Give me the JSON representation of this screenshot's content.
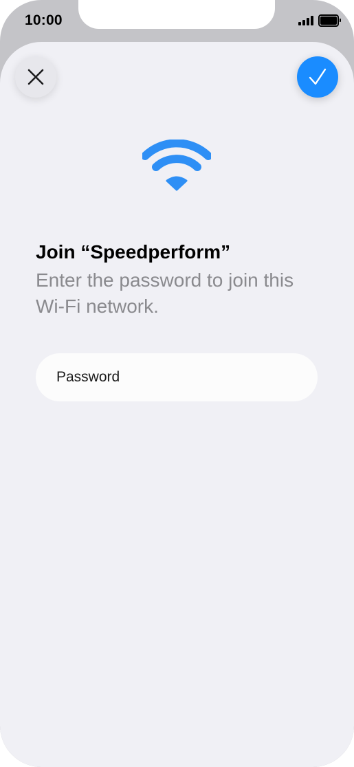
{
  "status_bar": {
    "time": "10:00",
    "signal_icon": "cellular-signal-icon",
    "battery_icon": "battery-full-icon"
  },
  "toolbar": {
    "close_icon": "close-icon",
    "confirm_icon": "checkmark-icon"
  },
  "content": {
    "wifi_icon": "wifi-icon",
    "title": "Join “Speedperform”",
    "subtitle": "Enter the password to join this Wi-Fi network."
  },
  "password": {
    "placeholder": "Password",
    "value": ""
  },
  "colors": {
    "accent": "#1a8cff",
    "wifi": "#2e8ff5",
    "sheet_background": "#f0f0f5",
    "secondary_text": "#8a8a8e"
  }
}
